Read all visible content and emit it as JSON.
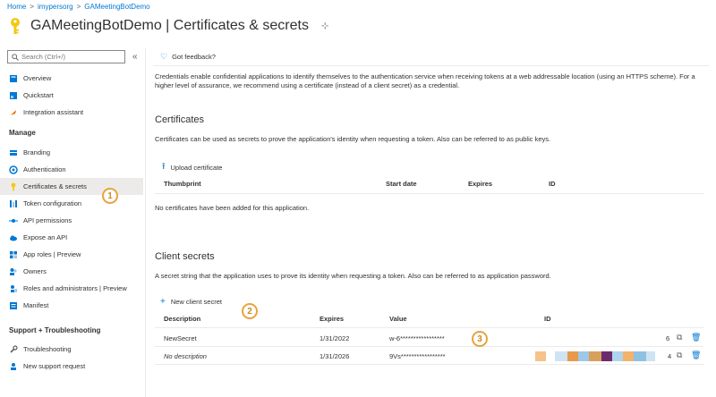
{
  "breadcrumb": [
    "Home",
    "imypersorg",
    "GAMeetingBotDemo"
  ],
  "title": "GAMeetingBotDemo | Certificates & secrets",
  "search": {
    "placeholder": "Search (Ctrl+/)"
  },
  "collapse_glyph": "«",
  "pin_glyph": "⊹",
  "sidebar": {
    "top_items": [
      {
        "label": "Overview",
        "icon": "overview-icon"
      },
      {
        "label": "Quickstart",
        "icon": "quickstart-icon"
      },
      {
        "label": "Integration assistant",
        "icon": "rocket-icon"
      }
    ],
    "manage_label": "Manage",
    "manage_items": [
      {
        "label": "Branding",
        "icon": "branding-icon"
      },
      {
        "label": "Authentication",
        "icon": "authentication-icon"
      },
      {
        "label": "Certificates & secrets",
        "icon": "key-icon",
        "active": true
      },
      {
        "label": "Token configuration",
        "icon": "token-icon"
      },
      {
        "label": "API permissions",
        "icon": "api-permissions-icon"
      },
      {
        "label": "Expose an API",
        "icon": "cloud-icon"
      },
      {
        "label": "App roles | Preview",
        "icon": "app-roles-icon"
      },
      {
        "label": "Owners",
        "icon": "owners-icon"
      },
      {
        "label": "Roles and administrators | Preview",
        "icon": "roles-icon"
      },
      {
        "label": "Manifest",
        "icon": "manifest-icon"
      }
    ],
    "support_label": "Support + Troubleshooting",
    "support_items": [
      {
        "label": "Troubleshooting",
        "icon": "wrench-icon"
      },
      {
        "label": "New support request",
        "icon": "support-icon"
      }
    ]
  },
  "feedback_label": "Got feedback?",
  "intro_text": "Credentials enable confidential applications to identify themselves to the authentication service when receiving tokens at a web addressable location (using an HTTPS scheme). For a higher level of assurance, we recommend using a certificate (instead of a client secret) as a credential.",
  "certificates": {
    "heading": "Certificates",
    "description": "Certificates can be used as secrets to prove the application's identity when requesting a token. Also can be referred to as public keys.",
    "upload_label": "Upload certificate",
    "columns": [
      "Thumbprint",
      "Start date",
      "Expires",
      "ID"
    ],
    "empty_text": "No certificates have been added for this application."
  },
  "client_secrets": {
    "heading": "Client secrets",
    "description": "A secret string that the application uses to prove its identity when requesting a token. Also can be referred to as application password.",
    "new_label": "New client secret",
    "columns": [
      "Description",
      "Expires",
      "Value",
      "ID"
    ],
    "rows": [
      {
        "description": "NewSecret",
        "expires": "1/31/2022",
        "value": "w-6*****************",
        "id_suffix": "6"
      },
      {
        "description": "No description",
        "expires": "1/31/2026",
        "value": "9Vs*****************",
        "id_suffix": "4"
      }
    ]
  },
  "annotations": [
    "1",
    "2",
    "3"
  ],
  "colors": {
    "accent": "#0078d4",
    "badge_border": "#e8a33d",
    "key_yellow": "#f2c811",
    "blur_palette": [
      "#f6c28b",
      "#cfe3f3",
      "#e79a4a",
      "#9cc9e8",
      "#d9a05b",
      "#6b2c6e",
      "#aed4ee",
      "#f3b36a",
      "#8fc1e3"
    ]
  }
}
